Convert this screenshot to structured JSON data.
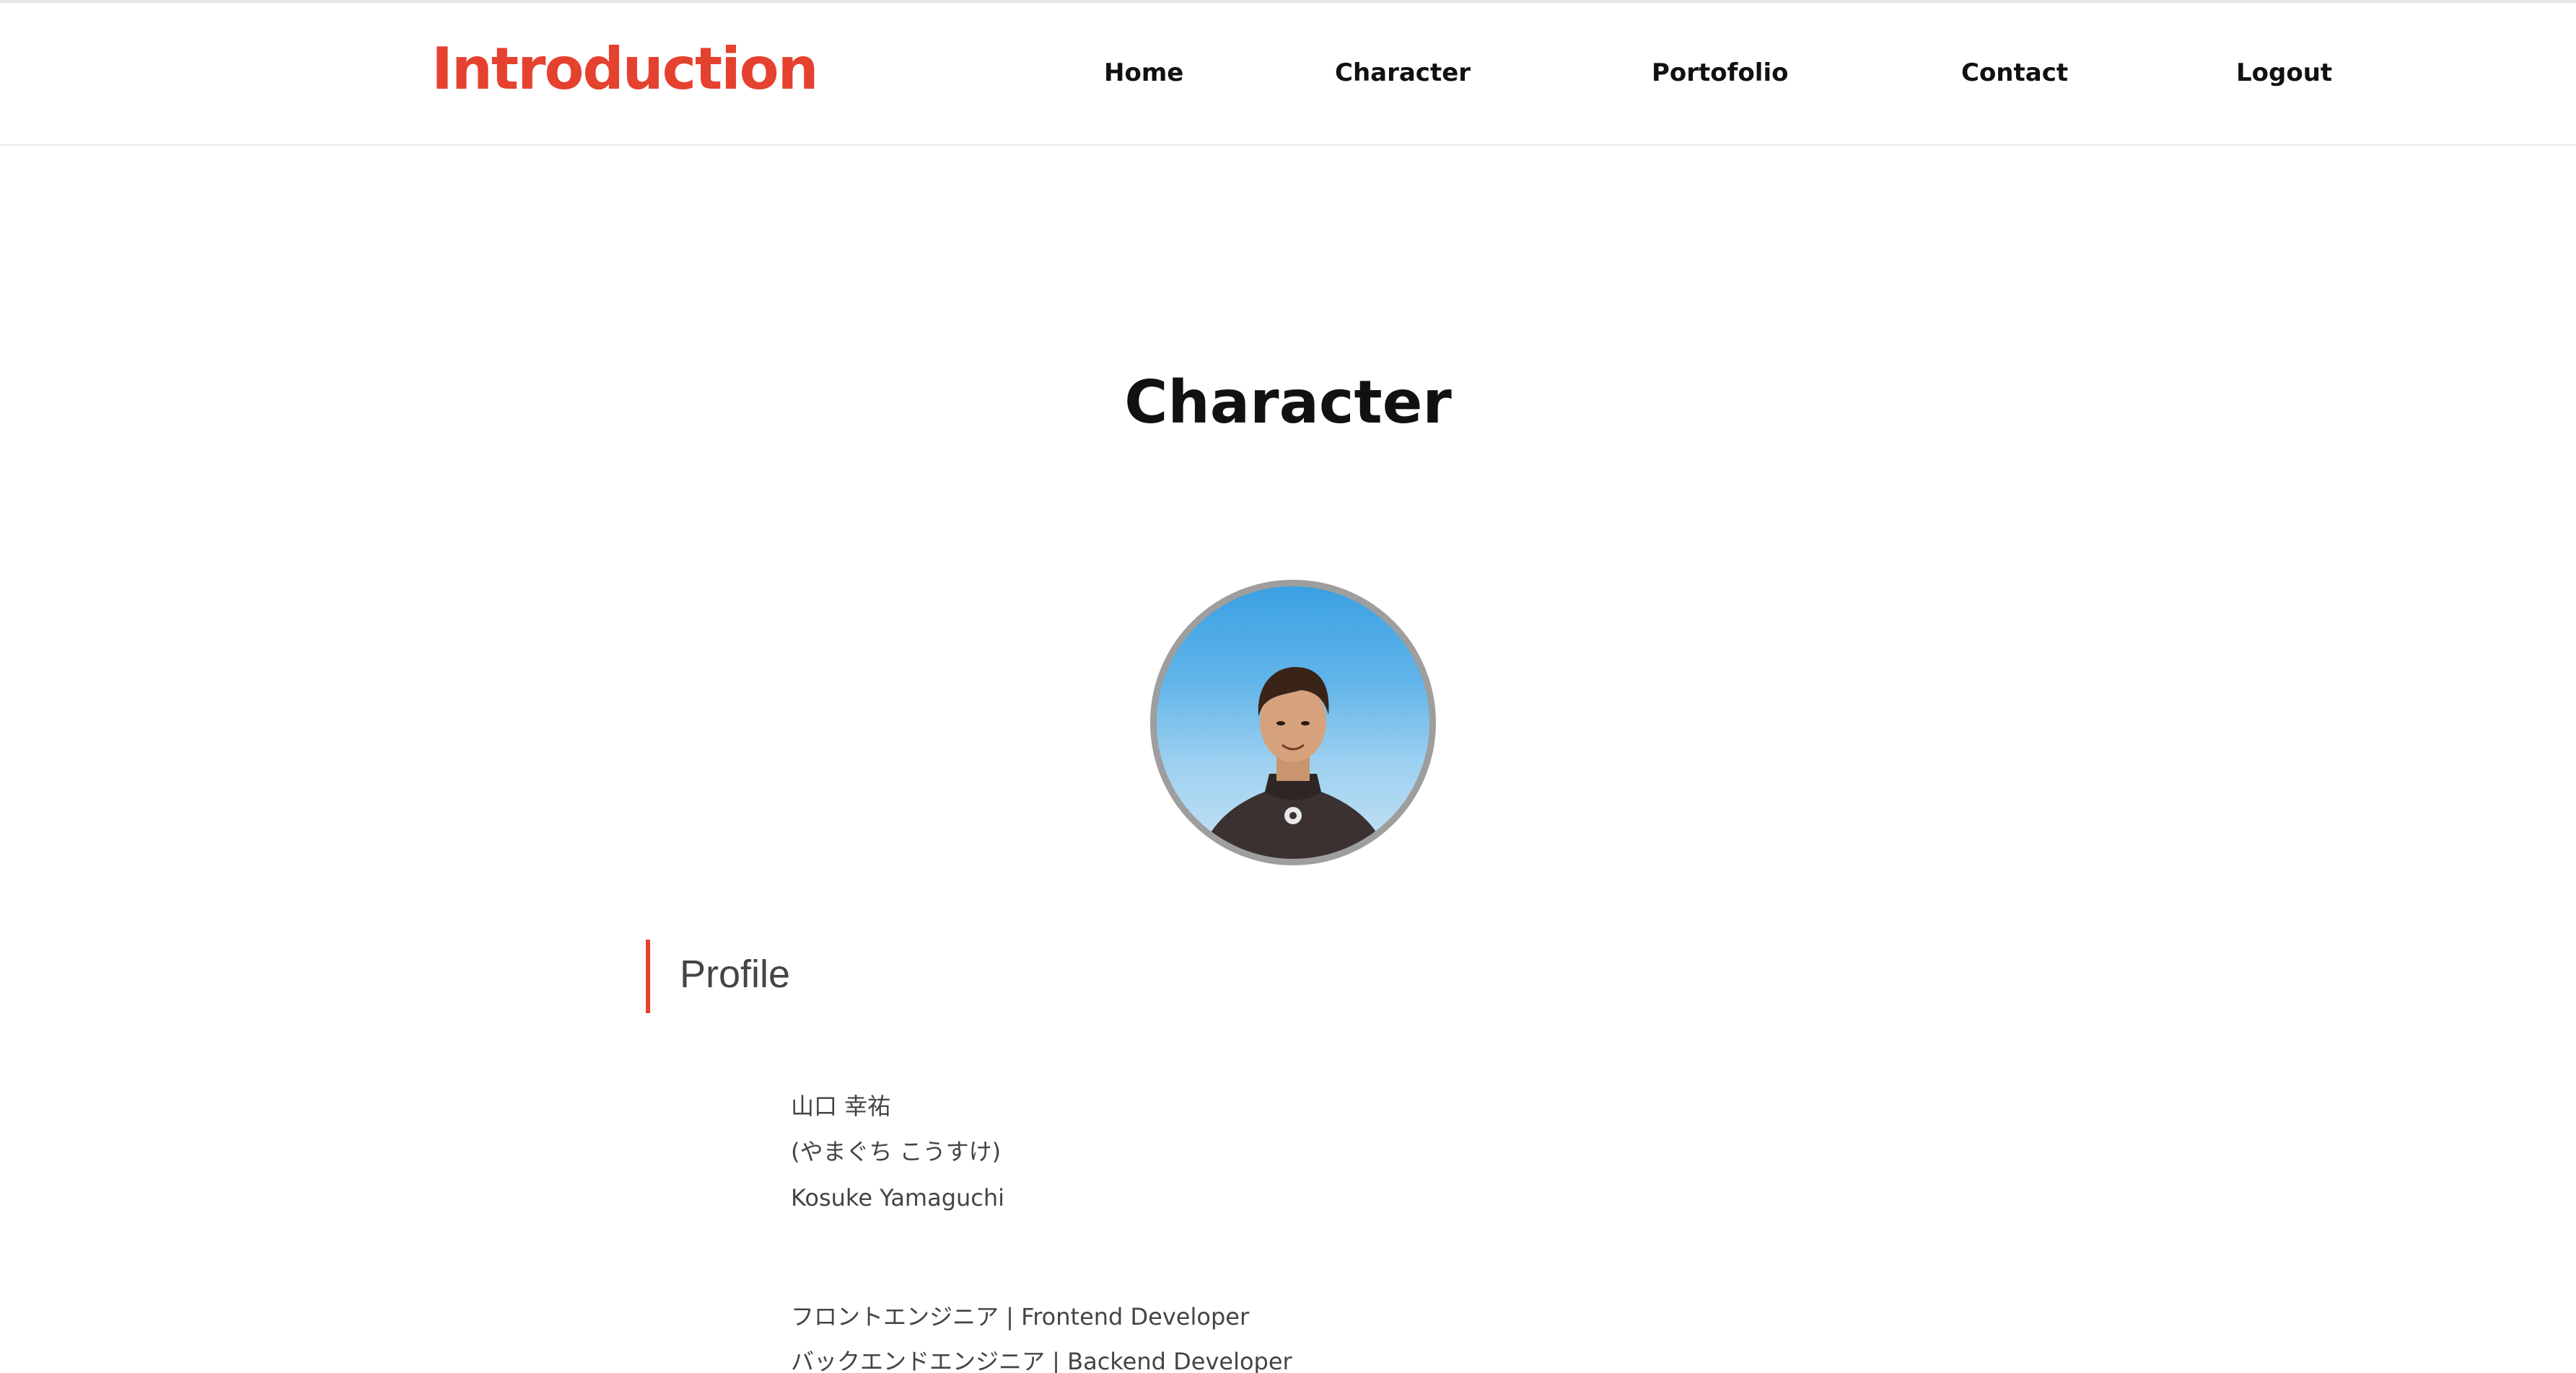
{
  "header": {
    "logo": "Introduction",
    "nav": [
      {
        "label": "Home"
      },
      {
        "label": "Character"
      },
      {
        "label": "Portofolio"
      },
      {
        "label": "Contact"
      },
      {
        "label": "Logout"
      }
    ]
  },
  "main": {
    "title": "Character",
    "section_title": "Profile",
    "profile": {
      "name_kanji": "山口 幸祐",
      "name_kana": "(やまぐち こうすけ)",
      "name_en": "Kosuke Yamaguchi",
      "role_frontend": "フロントエンジニア | Frontend Developer",
      "role_backend": "バックエンドエンジニア | Backend Developer"
    }
  },
  "colors": {
    "accent": "#e5412f",
    "text": "#111111",
    "muted_text": "#444444",
    "avatar_border": "#9e9e9e"
  },
  "icons": {
    "avatar": "profile-photo"
  }
}
